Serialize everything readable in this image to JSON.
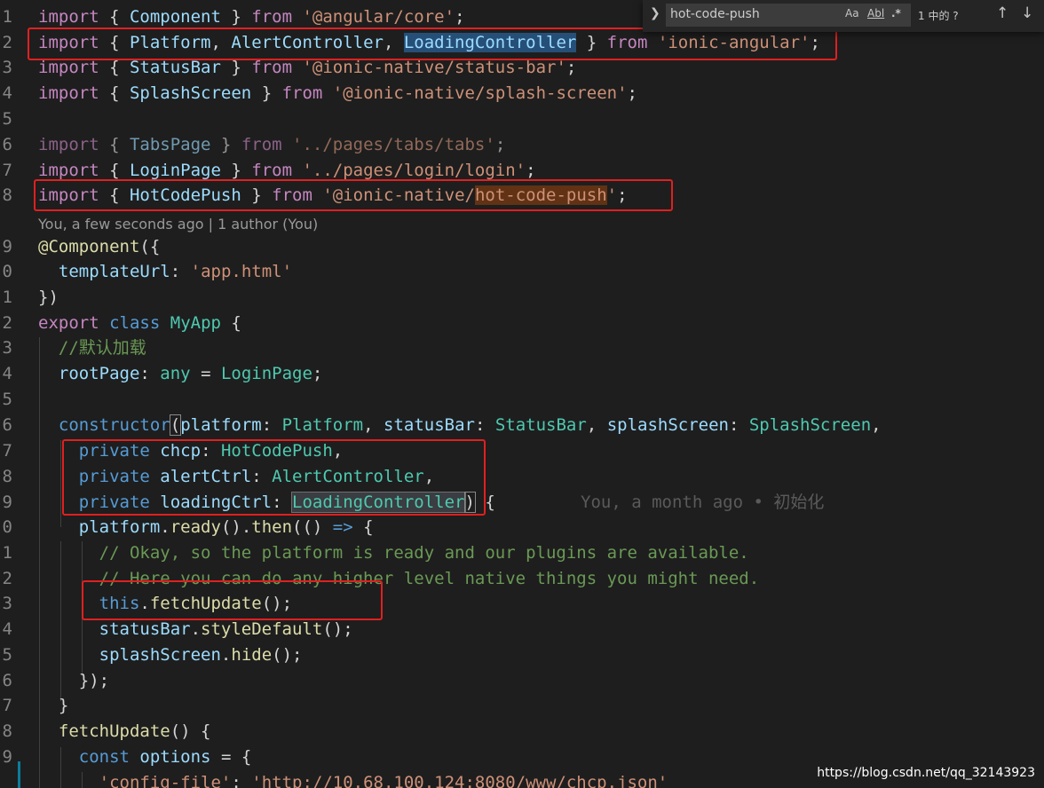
{
  "find_widget": {
    "query": "hot-code-push",
    "match_case": "Aa",
    "whole_word": "Abl",
    "regex": ".*",
    "result_count": "1 中的 ?",
    "prev": "↑",
    "next": "↓"
  },
  "codelens": "You, a few seconds ago | 1 author (You)",
  "inline_blame": "You, a month ago • 初始化",
  "watermark": "https://blog.csdn.net/qq_32143923",
  "line_numbers": [
    "1",
    "2",
    "3",
    "4",
    "5",
    "6",
    "7",
    "8",
    "9",
    "0",
    "1",
    "2",
    "3",
    "4",
    "5",
    "6",
    "7",
    "8",
    "9",
    "0",
    "1",
    "2",
    "3",
    "4",
    "5",
    "6",
    "7",
    "8",
    "9",
    ""
  ],
  "code": {
    "l1": [
      "import",
      " { ",
      "Component",
      " } ",
      "from",
      " ",
      "'@angular/core'",
      ";"
    ],
    "l2": [
      "import",
      " { ",
      "Platform",
      ", ",
      "AlertController",
      ", ",
      "LoadingController",
      " } ",
      "from",
      " ",
      "'ionic-angular'",
      ";"
    ],
    "l3": [
      "import",
      " { ",
      "StatusBar",
      " } ",
      "from",
      " ",
      "'@ionic-native/status-bar'",
      ";"
    ],
    "l4": [
      "import",
      " { ",
      "SplashScreen",
      " } ",
      "from",
      " ",
      "'@ionic-native/splash-screen'",
      ";"
    ],
    "l6": [
      "import",
      " { ",
      "TabsPage",
      " } ",
      "from",
      " ",
      "'../pages/tabs/tabs'",
      ";"
    ],
    "l7": [
      "import",
      " { ",
      "LoginPage",
      " } ",
      "from",
      " ",
      "'../pages/login/login'",
      ";"
    ],
    "l8": [
      "import",
      " { ",
      "HotCodePush",
      " } ",
      "from",
      " ",
      "'@ionic-native/",
      "hot-code-push",
      "'",
      ";"
    ],
    "l9": [
      "@",
      "Component",
      "({"
    ],
    "l10": [
      "  ",
      "templateUrl",
      ": ",
      "'app.html'"
    ],
    "l11": [
      "})"
    ],
    "l12": [
      "export",
      " ",
      "class",
      " ",
      "MyApp",
      " {"
    ],
    "l13": [
      "  ",
      "//默认加载"
    ],
    "l14": [
      "  ",
      "rootPage",
      ": ",
      "any",
      " = ",
      "LoginPage",
      ";"
    ],
    "l16": [
      "  ",
      "constructor",
      "(",
      "platform",
      ": ",
      "Platform",
      ", ",
      "statusBar",
      ": ",
      "StatusBar",
      ", ",
      "splashScreen",
      ": ",
      "SplashScreen",
      ","
    ],
    "l17": [
      "    ",
      "private",
      " ",
      "chcp",
      ": ",
      "HotCodePush",
      ","
    ],
    "l18": [
      "    ",
      "private",
      " ",
      "alertCtrl",
      ": ",
      "AlertController",
      ","
    ],
    "l19": [
      "    ",
      "private",
      " ",
      "loadingCtrl",
      ": ",
      "LoadingController",
      ")",
      " {"
    ],
    "l20": [
      "    ",
      "platform",
      ".",
      "ready",
      "().",
      "then",
      "(() ",
      "=>",
      " {"
    ],
    "l21": [
      "      ",
      "// Okay, so the platform is ready and our plugins are available."
    ],
    "l22": [
      "      ",
      "// Here you can do any higher level native things you might need."
    ],
    "l23": [
      "      ",
      "this",
      ".",
      "fetchUpdate",
      "();"
    ],
    "l24": [
      "      ",
      "statusBar",
      ".",
      "styleDefault",
      "();"
    ],
    "l25": [
      "      ",
      "splashScreen",
      ".",
      "hide",
      "();"
    ],
    "l26": [
      "    ",
      "});"
    ],
    "l27": [
      "  ",
      "}"
    ],
    "l28": [
      "  ",
      "fetchUpdate",
      "() {"
    ],
    "l29": [
      "    ",
      "const",
      " ",
      "options",
      " = {"
    ],
    "l30": [
      "      ",
      "'config-file'",
      ": ",
      "'http://10.68.100.124:8080/www/chcp.json'"
    ]
  },
  "colors": {
    "background": "#1e1e1e",
    "keyword": "#c586c0",
    "storage": "#569cd6",
    "type": "#4ec9b0",
    "string": "#ce9178",
    "variable": "#9cdcfe",
    "function": "#dcdcaa",
    "comment": "#6a9955",
    "highlight_box": "#e02020"
  }
}
